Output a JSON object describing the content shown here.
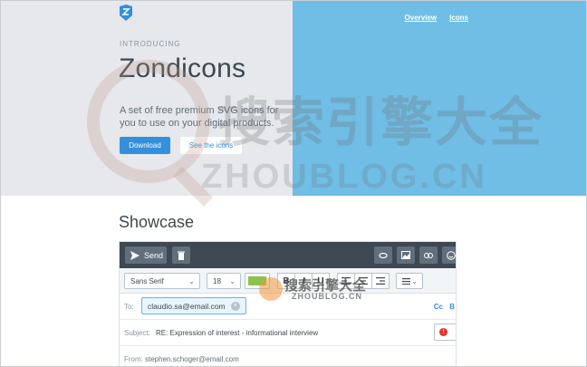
{
  "header": {
    "eyebrow": "INTRODUCING",
    "title": "Zondicons",
    "description": "A set of free premium SVG icons for you to use on your digital products.",
    "download_label": "Download",
    "see_icons_label": "See the icons",
    "nav": [
      "Overview",
      "Icons"
    ]
  },
  "showcase": {
    "title": "Showcase"
  },
  "composer": {
    "send_label": "Send",
    "font_family": "Sans Serif",
    "font_size": "18",
    "bold_label": "B",
    "italic_label": "I",
    "underline_label": "U",
    "to_label": "To:",
    "to_value": "claudio.sa@email.com",
    "cc_label": "Cc",
    "bcc_label": "B",
    "subject_label": "Subject:",
    "subject_value": "RE: Expression of interest - informational interview",
    "from_label": "From:",
    "from_value": "stephen.schoger@email.com"
  },
  "watermark": {
    "cn_large": "搜索引擎大全",
    "en_large": "ZHOUBLOG.CN",
    "cn_small": "搜索引擎大全",
    "en_small": "ZHOUBLOG.CN"
  },
  "colors": {
    "primary": "#3490dc",
    "hero_right": "#70bde6",
    "hero_left": "#e6e8eb",
    "toolbar_dark": "#3d4852"
  }
}
